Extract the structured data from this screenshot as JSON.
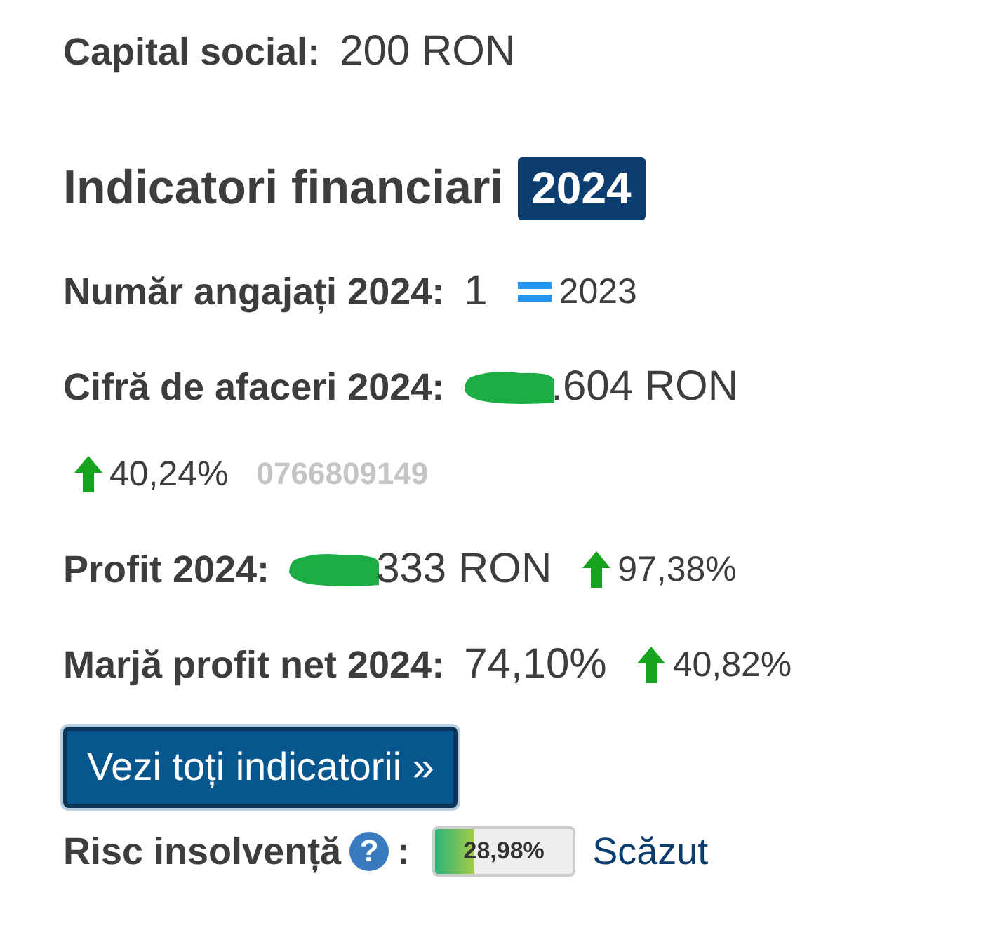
{
  "capital": {
    "label": "Capital social:",
    "value": "200 RON"
  },
  "heading": {
    "title": "Indicatori financiari",
    "year": "2024"
  },
  "indicators": [
    {
      "label": "Număr angajați 2024:",
      "value": "1",
      "redacted": false,
      "trend_below": false,
      "trend": {
        "kind": "equal",
        "text": "2023"
      }
    },
    {
      "label": "Cifră de afaceri 2024:",
      "value": ".604 RON",
      "redacted": true,
      "trend_below": true,
      "trend": {
        "kind": "up",
        "text": "40,24%"
      },
      "note": "0766809149"
    },
    {
      "label": "Profit 2024:",
      "value": "333 RON",
      "redacted": true,
      "trend_below": false,
      "trend": {
        "kind": "up",
        "text": "97,38%"
      }
    },
    {
      "label": "Marjă profit net 2024:",
      "value": "74,10%",
      "redacted": false,
      "trend_below": false,
      "trend": {
        "kind": "up",
        "text": "40,82%"
      }
    }
  ],
  "button": "Vezi toți indicatorii »",
  "risk": {
    "label": "Risc insolvență",
    "help": "?",
    "colon": ":",
    "level": 0.29,
    "reading": "28,98%",
    "verdict": "Scăzut"
  }
}
